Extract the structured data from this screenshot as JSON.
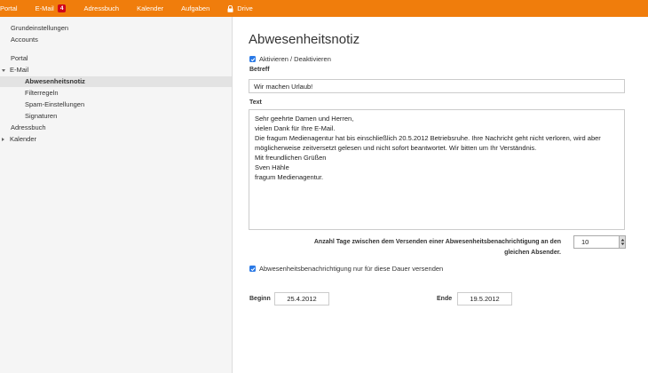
{
  "topbar": {
    "items": [
      {
        "label": "Portal"
      },
      {
        "label": "E-Mail",
        "badge": "4"
      },
      {
        "label": "Adressbuch"
      },
      {
        "label": "Kalender"
      },
      {
        "label": "Aufgaben"
      },
      {
        "label": "Drive",
        "icon": "lock-icon"
      }
    ],
    "color": "#f07d0c",
    "badge_color": "#d0021b"
  },
  "sidebar": {
    "items": [
      {
        "label": "Grundeinstellungen"
      },
      {
        "label": "Accounts"
      },
      {
        "label": "Portal"
      },
      {
        "label": "E-Mail",
        "expanded": true
      },
      {
        "label": "Abwesenheitsnotiz",
        "active": true
      },
      {
        "label": "Filterregeln"
      },
      {
        "label": "Spam-Einstellungen"
      },
      {
        "label": "Signaturen"
      },
      {
        "label": "Adressbuch"
      },
      {
        "label": "Kalender",
        "expanded": false
      }
    ]
  },
  "main": {
    "title": "Abwesenheitsnotiz",
    "activate_label": "Aktivieren / Deaktivieren",
    "subject_label": "Betreff",
    "subject_value": "Wir machen Urlaub!",
    "text_label": "Text",
    "text_value": "Sehr geehrte Damen und Herren,\nvielen Dank für Ihre E-Mail.\nDie fragum Medienagentur hat bis einschließlich 20.5.2012 Betriebsruhe. Ihre Nachricht geht nicht verloren, wird aber möglicherweise zeitversetzt gelesen und nicht sofort beantwortet. Wir bitten um Ihr Verständnis.\nMit freundlichen Grüßen\nSven Hähle\nfragum Medienagentur.",
    "days_label": "Anzahl Tage zwischen dem Versenden einer Abwesenheitsbenachrichtigung an den gleichen Absender.",
    "days_value": "10",
    "duration_label": "Abwesenheitsbenachrichtigung nur für diese Dauer versenden",
    "begin_label": "Beginn",
    "begin_value": "25.4.2012",
    "end_label": "Ende",
    "end_value": "19.5.2012",
    "checkbox_color": "#2a79e6"
  }
}
